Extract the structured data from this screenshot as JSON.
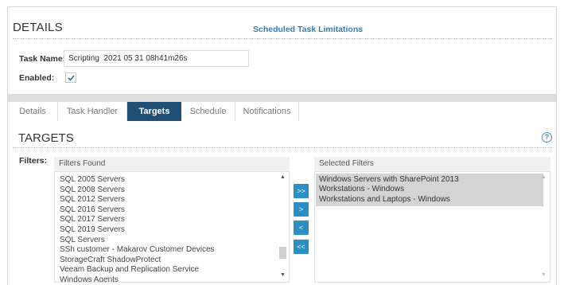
{
  "details": {
    "title": "DETAILS",
    "scheduled_link": "Scheduled Task Limitations",
    "task_name_label": "Task Name:",
    "task_name_value": "Scripting  2021 05 31 08h41m26s",
    "enabled_label": "Enabled:",
    "enabled_checked": true
  },
  "tabs": [
    {
      "label": "Details",
      "active": false
    },
    {
      "label": "Task Handler",
      "active": false
    },
    {
      "label": "Targets",
      "active": true
    },
    {
      "label": "Schedule",
      "active": false
    },
    {
      "label": "Notifications",
      "active": false
    }
  ],
  "targets": {
    "title": "TARGETS",
    "filters_label": "Filters:",
    "found_header": "Filters Found",
    "selected_header": "Selected Filters",
    "found_items": [
      "SQL 2005 Servers",
      "SQL 2008 Servers",
      "SQL 2012 Servers",
      "SQL 2016 Servers",
      "SQL 2017 Servers",
      "SQL 2019 Servers",
      "SQL Servers",
      "SSh customer - Makarov Customer Devices",
      "StorageCraft ShadowProtect",
      "Veeam Backup and Replication Service",
      "Windows Agents"
    ],
    "selected_items": [
      "Windows Servers with SharePoint 2013",
      "Workstations - Windows",
      "Workstations and Laptops - Windows"
    ],
    "buttons": {
      "add_all": ">>",
      "add": ">",
      "remove": "<",
      "remove_all": "<<"
    }
  },
  "colors": {
    "accent": "#2b8fc4",
    "active_tab": "#1f4f74",
    "link": "#2e7fb8",
    "selected_bg": "#d4d4d4"
  },
  "icons": [
    "checkmark-icon",
    "help-icon",
    "scroll-up-icon",
    "scroll-down-icon"
  ]
}
